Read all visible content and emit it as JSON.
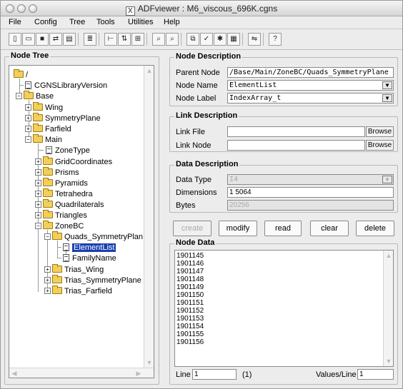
{
  "window": {
    "title": "ADFviewer : M6_viscous_696K.cgns",
    "x_icon": "X"
  },
  "menu": [
    "File",
    "Config",
    "Tree",
    "Tools",
    "Utilities",
    "Help"
  ],
  "toolbar": {
    "icons": [
      "new-file-icon",
      "open-folder-icon",
      "save-icon",
      "save-as-icon",
      "properties-icon",
      "node-list-icon",
      "tree-view-icon",
      "sort-icon",
      "tree-expand-icon",
      "find-icon",
      "find-next-icon",
      "copy-icon",
      "paste-icon",
      "plot-icon",
      "table-icon",
      "link-icon",
      "help-icon"
    ],
    "help_glyph": "?"
  },
  "node_tree": {
    "title": "Node Tree",
    "items": [
      {
        "label": "/",
        "type": "folder",
        "expanded": true
      },
      {
        "label": "CGNSLibraryVersion",
        "type": "doc"
      },
      {
        "label": "Base",
        "type": "folder",
        "expanded": true
      },
      {
        "label": "Wing",
        "type": "folder",
        "expanded": false
      },
      {
        "label": "SymmetryPlane",
        "type": "folder",
        "expanded": false
      },
      {
        "label": "Farfield",
        "type": "folder",
        "expanded": false
      },
      {
        "label": "Main",
        "type": "folder",
        "expanded": true
      },
      {
        "label": "ZoneType",
        "type": "doc"
      },
      {
        "label": "GridCoordinates",
        "type": "folder",
        "expanded": false
      },
      {
        "label": "Prisms",
        "type": "folder",
        "expanded": false
      },
      {
        "label": "Pyramids",
        "type": "folder",
        "expanded": false
      },
      {
        "label": "Tetrahedra",
        "type": "folder",
        "expanded": false
      },
      {
        "label": "Quadrilaterals",
        "type": "folder",
        "expanded": false
      },
      {
        "label": "Triangles",
        "type": "folder",
        "expanded": false
      },
      {
        "label": "ZoneBC",
        "type": "folder",
        "expanded": true
      },
      {
        "label": "Quads_SymmetryPlan",
        "type": "folder",
        "expanded": true
      },
      {
        "label": "ElementList",
        "type": "doc",
        "selected": true
      },
      {
        "label": "FamilyName",
        "type": "doc"
      },
      {
        "label": "Trias_Wing",
        "type": "folder",
        "expanded": false
      },
      {
        "label": "Trias_SymmetryPlane",
        "type": "folder",
        "expanded": false
      },
      {
        "label": "Trias_Farfield",
        "type": "folder",
        "expanded": false
      }
    ]
  },
  "node_description": {
    "title": "Node Description",
    "parent_node_label": "Parent Node",
    "parent_node_value": "/Base/Main/ZoneBC/Quads_SymmetryPlane",
    "node_name_label": "Node Name",
    "node_name_value": "ElementList",
    "node_label_label": "Node Label",
    "node_label_value": "IndexArray_t"
  },
  "link_description": {
    "title": "Link Description",
    "link_file_label": "Link File",
    "link_file_value": "",
    "link_node_label": "Link Node",
    "link_node_value": "",
    "browse_label": "Browse"
  },
  "data_description": {
    "title": "Data Description",
    "data_type_label": "Data Type",
    "data_type_value": "I4",
    "dimensions_label": "Dimensions",
    "dimensions_value": "1  5064",
    "bytes_label": "Bytes",
    "bytes_value": "20256"
  },
  "actions": {
    "create": "create",
    "modify": "modify",
    "read": "read",
    "clear": "clear",
    "delete": "delete"
  },
  "node_data": {
    "title": "Node Data",
    "values": [
      "1901145",
      "1901146",
      "1901147",
      "1901148",
      "1901149",
      "1901150",
      "1901151",
      "1901152",
      "1901153",
      "1901154",
      "1901155",
      "1901156"
    ],
    "line_label": "Line",
    "line_value": "1",
    "line_count": "(1)",
    "values_per_line_label": "Values/Line",
    "values_per_line_value": "1"
  },
  "colors": {
    "selection": "#1a3fb0",
    "folder": "#f2cf5a",
    "window_bg": "#ececec"
  }
}
